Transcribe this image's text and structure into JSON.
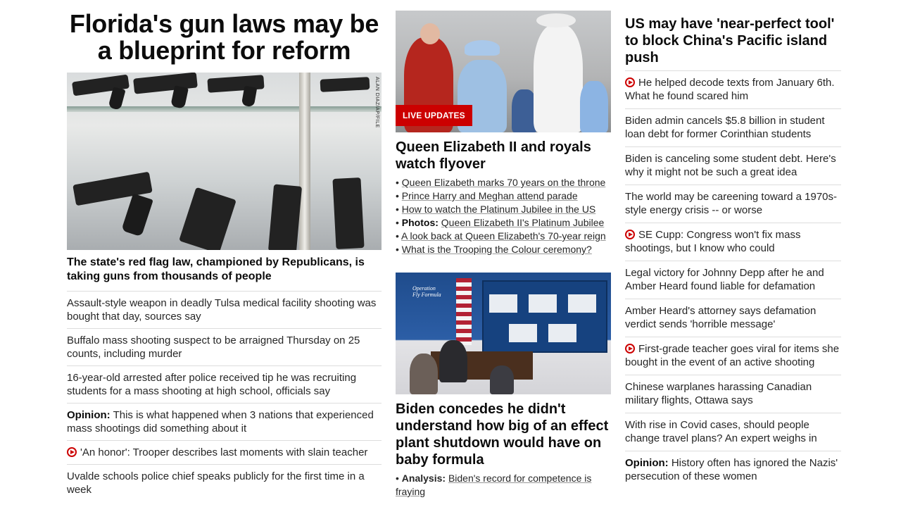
{
  "left": {
    "headline": "Florida's gun laws may be a blueprint for reform",
    "photo_credit": "ALAN DIAZ/AP/FILE",
    "dek": "The state's red flag law, championed by Republicans, is taking guns from thousands of people",
    "items": [
      {
        "text": "Assault-style weapon in deadly Tulsa medical facility shooting was bought that day, sources say"
      },
      {
        "text": "Buffalo mass shooting suspect to be arraigned Thursday on 25 counts, including murder"
      },
      {
        "text": "16-year-old arrested after police received tip he was recruiting students for a mass shooting at high school, officials say"
      },
      {
        "prefix": "Opinion:",
        "text": "This is what happened when 3 nations that experienced mass shootings did something about it"
      },
      {
        "video": true,
        "text": "'An honor': Trooper describes last moments with slain teacher"
      },
      {
        "text": "Uvalde schools police chief speaks publicly for the first time in a week"
      }
    ]
  },
  "middle": {
    "live_badge": "LIVE UPDATES",
    "story1": {
      "headline": "Queen Elizabeth II and royals watch flyover",
      "bullets": [
        {
          "text": "Queen Elizabeth marks 70 years on the throne"
        },
        {
          "text": "Prince Harry and Meghan attend parade"
        },
        {
          "text": "How to watch the Platinum Jubilee in the US"
        },
        {
          "prefix": "Photos:",
          "text": "Queen Elizabeth II's Platinum Jubilee"
        },
        {
          "text": "A look back at Queen Elizabeth's 70-year reign"
        },
        {
          "text": "What is the Trooping the Colour ceremony?"
        }
      ]
    },
    "photo2_logo_line1": "Operation",
    "photo2_logo_line2": "Fly Formula",
    "story2": {
      "headline": "Biden concedes he didn't understand how big of an effect plant shutdown would have on baby formula",
      "bullet_prefix": "Analysis:",
      "bullet_text": "Biden's record for competence is fraying"
    }
  },
  "right": {
    "headline": "US may have 'near-perfect tool' to block China's Pacific island push",
    "items": [
      {
        "video": true,
        "text": "He helped decode texts from January 6th. What he found scared him"
      },
      {
        "text": "Biden admin cancels $5.8 billion in student loan debt for former Corinthian students"
      },
      {
        "text": "Biden is canceling some student debt. Here's why it might not be such a great idea"
      },
      {
        "text": "The world may be careening toward a 1970s-style energy crisis -- or worse"
      },
      {
        "video": true,
        "text": "SE Cupp: Congress won't fix mass shootings, but I know who could"
      },
      {
        "text": "Legal victory for Johnny Depp after he and Amber Heard found liable for defamation"
      },
      {
        "text": "Amber Heard's attorney says defamation verdict sends 'horrible message'"
      },
      {
        "video": true,
        "text": "First-grade teacher goes viral for items she bought in the event of an active shooting"
      },
      {
        "text": "Chinese warplanes harassing Canadian military flights, Ottawa says"
      },
      {
        "text": "With rise in Covid cases, should people change travel plans? An expert weighs in"
      },
      {
        "prefix": "Opinion:",
        "text": "History often has ignored the Nazis' persecution of these women"
      }
    ]
  },
  "colors": {
    "accent": "#cc0000",
    "divider": "#dddddd",
    "text": "#0c0c0c"
  }
}
